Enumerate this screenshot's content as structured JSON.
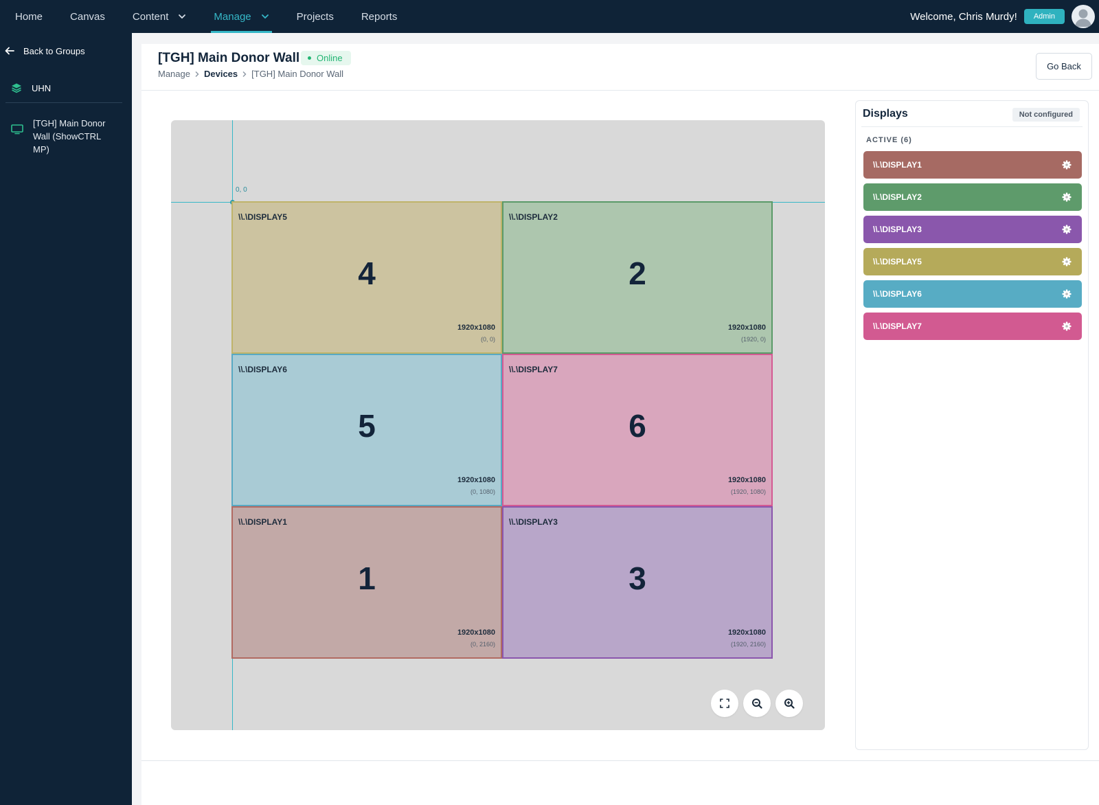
{
  "nav": {
    "items": [
      {
        "label": "Home"
      },
      {
        "label": "Canvas"
      },
      {
        "label": "Content"
      },
      {
        "label": "Manage"
      },
      {
        "label": "Projects"
      },
      {
        "label": "Reports"
      }
    ],
    "active": "Manage",
    "welcome": "Welcome, Chris Murdy!",
    "role_badge": "Admin"
  },
  "sidebar": {
    "back_label": "Back to Groups",
    "group_name": "UHN",
    "device_name": "[TGH] Main Donor Wall (ShowCTRL MP)"
  },
  "header": {
    "title": "[TGH] Main Donor Wall",
    "status": "Online",
    "breadcrumb": [
      "Manage",
      "Devices",
      "[TGH] Main Donor Wall"
    ],
    "go_back": "Go Back"
  },
  "canvas": {
    "origin_label": "0, 0",
    "tiles": [
      {
        "name": "\\\\.\\DISPLAY5",
        "number": "4",
        "resolution": "1920x1080",
        "position": "(0, 0)",
        "fill": "#ccc3a0",
        "border": "#bfb46a"
      },
      {
        "name": "\\\\.\\DISPLAY2",
        "number": "2",
        "resolution": "1920x1080",
        "position": "(1920, 0)",
        "fill": "#adc6ae",
        "border": "#5a9a68"
      },
      {
        "name": "\\\\.\\DISPLAY6",
        "number": "5",
        "resolution": "1920x1080",
        "position": "(0, 1080)",
        "fill": "#a9cbd5",
        "border": "#58a9c3"
      },
      {
        "name": "\\\\.\\DISPLAY7",
        "number": "6",
        "resolution": "1920x1080",
        "position": "(1920, 1080)",
        "fill": "#d9a6bd",
        "border": "#d45a92"
      },
      {
        "name": "\\\\.\\DISPLAY1",
        "number": "1",
        "resolution": "1920x1080",
        "position": "(0, 2160)",
        "fill": "#c2a9a7",
        "border": "#b16a61"
      },
      {
        "name": "\\\\.\\DISPLAY3",
        "number": "3",
        "resolution": "1920x1080",
        "position": "(1920, 2160)",
        "fill": "#b8a6c9",
        "border": "#8b55ad"
      }
    ],
    "controls": [
      "fit-screen-icon",
      "zoom-out-icon",
      "zoom-in-icon"
    ]
  },
  "displays_panel": {
    "title": "Displays",
    "badge": "Not configured",
    "active_label": "ACTIVE (6)",
    "items": [
      {
        "label": "\\\\.\\DISPLAY1",
        "color": "#a66a63"
      },
      {
        "label": "\\\\.\\DISPLAY2",
        "color": "#5e9b6b"
      },
      {
        "label": "\\\\.\\DISPLAY3",
        "color": "#8a57ac"
      },
      {
        "label": "\\\\.\\DISPLAY5",
        "color": "#b5aa5a"
      },
      {
        "label": "\\\\.\\DISPLAY6",
        "color": "#57acc4"
      },
      {
        "label": "\\\\.\\DISPLAY7",
        "color": "#d25a91"
      }
    ]
  }
}
